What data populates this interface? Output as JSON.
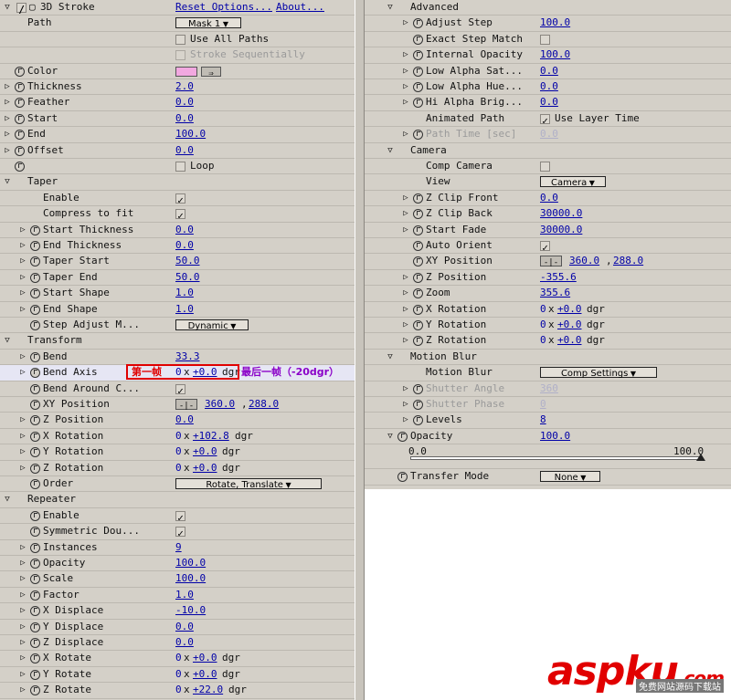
{
  "left_rows": [
    {
      "indent": 0,
      "twirl": "open",
      "fx": true,
      "label": "3D Stroke",
      "link1": "Reset Options...",
      "link2": "About..."
    },
    {
      "indent": 0,
      "label": "Path",
      "dropdown": "Mask 1"
    },
    {
      "indent": 0,
      "checkbox": false,
      "text": "Use All Paths"
    },
    {
      "indent": 0,
      "checkbox": false,
      "text": "Stroke Sequentially",
      "disabled": true
    },
    {
      "indent": 0,
      "stopwatch": true,
      "label": "Color",
      "swatch": "#f2a8e0"
    },
    {
      "indent": 0,
      "twirl": "closed",
      "stopwatch": true,
      "label": "Thickness",
      "value": "2.0"
    },
    {
      "indent": 0,
      "twirl": "closed",
      "stopwatch": true,
      "label": "Feather",
      "value": "0.0"
    },
    {
      "indent": 0,
      "twirl": "closed",
      "stopwatch": true,
      "label": "Start",
      "value": "0.0"
    },
    {
      "indent": 0,
      "twirl": "closed",
      "stopwatch": true,
      "label": "End",
      "value": "100.0"
    },
    {
      "indent": 0,
      "twirl": "closed",
      "stopwatch": true,
      "label": "Offset",
      "value": "0.0"
    },
    {
      "indent": 0,
      "stopwatch": true,
      "checkbox": false,
      "text": "Loop"
    },
    {
      "indent": 0,
      "twirl": "open",
      "label": "Taper"
    },
    {
      "indent": 1,
      "label": "Enable",
      "checkbox": true
    },
    {
      "indent": 1,
      "label": "Compress to fit",
      "checkbox": true
    },
    {
      "indent": 1,
      "twirl": "closed",
      "stopwatch": true,
      "label": "Start Thickness",
      "value": "0.0"
    },
    {
      "indent": 1,
      "twirl": "closed",
      "stopwatch": true,
      "label": "End Thickness",
      "value": "0.0"
    },
    {
      "indent": 1,
      "twirl": "closed",
      "stopwatch": true,
      "label": "Taper Start",
      "value": "50.0"
    },
    {
      "indent": 1,
      "twirl": "closed",
      "stopwatch": true,
      "label": "Taper End",
      "value": "50.0"
    },
    {
      "indent": 1,
      "twirl": "closed",
      "stopwatch": true,
      "label": "Start Shape",
      "value": "1.0"
    },
    {
      "indent": 1,
      "twirl": "closed",
      "stopwatch": true,
      "label": "End Shape",
      "value": "1.0"
    },
    {
      "indent": 1,
      "stopwatch": true,
      "label": "Step Adjust M...",
      "dropdown": "Dynamic"
    },
    {
      "indent": 0,
      "twirl": "open",
      "label": "Transform"
    },
    {
      "indent": 1,
      "twirl": "closed",
      "stopwatch": true,
      "label": "Bend",
      "value": "33.3"
    },
    {
      "indent": 1,
      "twirl": "closed",
      "stopwatch": true,
      "label": "Bend Axis",
      "angle": [
        "0",
        "+0.0"
      ],
      "selected": true,
      "annot_first": "第一帧",
      "annot_last": "最后一帧（-20dgr）"
    },
    {
      "indent": 1,
      "stopwatch": true,
      "label": "Bend Around C...",
      "checkbox": true
    },
    {
      "indent": 1,
      "stopwatch": true,
      "label": "XY Position",
      "xy": [
        "360.0",
        "288.0"
      ]
    },
    {
      "indent": 1,
      "twirl": "closed",
      "stopwatch": true,
      "label": "Z Position",
      "value": "0.0"
    },
    {
      "indent": 1,
      "twirl": "closed",
      "stopwatch": true,
      "label": "X Rotation",
      "angle": [
        "0",
        "+102.8"
      ]
    },
    {
      "indent": 1,
      "twirl": "closed",
      "stopwatch": true,
      "label": "Y Rotation",
      "angle": [
        "0",
        "+0.0"
      ]
    },
    {
      "indent": 1,
      "twirl": "closed",
      "stopwatch": true,
      "label": "Z Rotation",
      "angle": [
        "0",
        "+0.0"
      ]
    },
    {
      "indent": 1,
      "stopwatch": true,
      "label": "Order",
      "dropdown": "Rotate, Translate"
    },
    {
      "indent": 0,
      "twirl": "open",
      "label": "Repeater"
    },
    {
      "indent": 1,
      "stopwatch": true,
      "label": "Enable",
      "checkbox": true
    },
    {
      "indent": 1,
      "stopwatch": true,
      "label": "Symmetric Dou...",
      "checkbox": true
    },
    {
      "indent": 1,
      "twirl": "closed",
      "stopwatch": true,
      "label": "Instances",
      "value": "9"
    },
    {
      "indent": 1,
      "twirl": "closed",
      "stopwatch": true,
      "label": "Opacity",
      "value": "100.0"
    },
    {
      "indent": 1,
      "twirl": "closed",
      "stopwatch": true,
      "label": "Scale",
      "value": "100.0"
    },
    {
      "indent": 1,
      "twirl": "closed",
      "stopwatch": true,
      "label": "Factor",
      "value": "1.0"
    },
    {
      "indent": 1,
      "twirl": "closed",
      "stopwatch": true,
      "label": "X Displace",
      "value": "-10.0"
    },
    {
      "indent": 1,
      "twirl": "closed",
      "stopwatch": true,
      "label": "Y Displace",
      "value": "0.0"
    },
    {
      "indent": 1,
      "twirl": "closed",
      "stopwatch": true,
      "label": "Z Displace",
      "value": "0.0"
    },
    {
      "indent": 1,
      "twirl": "closed",
      "stopwatch": true,
      "label": "X Rotate",
      "angle": [
        "0",
        "+0.0"
      ]
    },
    {
      "indent": 1,
      "twirl": "closed",
      "stopwatch": true,
      "label": "Y Rotate",
      "angle": [
        "0",
        "+0.0"
      ]
    },
    {
      "indent": 1,
      "twirl": "closed",
      "stopwatch": true,
      "label": "Z Rotate",
      "angle": [
        "0",
        "+22.0"
      ]
    }
  ],
  "right_rows": [
    {
      "indent": 0,
      "twirl": "open",
      "label": "Advanced"
    },
    {
      "indent": 1,
      "twirl": "closed",
      "stopwatch": true,
      "label": "Adjust Step",
      "value": "100.0"
    },
    {
      "indent": 1,
      "stopwatch": true,
      "label": "Exact Step Match",
      "checkbox": false
    },
    {
      "indent": 1,
      "twirl": "closed",
      "stopwatch": true,
      "label": "Internal Opacity",
      "value": "100.0"
    },
    {
      "indent": 1,
      "twirl": "closed",
      "stopwatch": true,
      "label": "Low Alpha Sat...",
      "value": "0.0"
    },
    {
      "indent": 1,
      "twirl": "closed",
      "stopwatch": true,
      "label": "Low Alpha Hue...",
      "value": "0.0"
    },
    {
      "indent": 1,
      "twirl": "closed",
      "stopwatch": true,
      "label": "Hi Alpha Brig...",
      "value": "0.0"
    },
    {
      "indent": 1,
      "label": "Animated Path",
      "checkbox": true,
      "text": "Use Layer Time"
    },
    {
      "indent": 1,
      "twirl": "closed",
      "stopwatch": true,
      "label": "Path Time [sec]",
      "value": "0.0",
      "disabled": true
    },
    {
      "indent": 0,
      "twirl": "open",
      "label": "Camera"
    },
    {
      "indent": 1,
      "label": "Comp Camera",
      "checkbox": false
    },
    {
      "indent": 1,
      "label": "View",
      "dropdown": "Camera"
    },
    {
      "indent": 1,
      "twirl": "closed",
      "stopwatch": true,
      "label": "Z Clip Front",
      "value": "0.0"
    },
    {
      "indent": 1,
      "twirl": "closed",
      "stopwatch": true,
      "label": "Z Clip Back",
      "value": "30000.0"
    },
    {
      "indent": 1,
      "twirl": "closed",
      "stopwatch": true,
      "label": "Start Fade",
      "value": "30000.0"
    },
    {
      "indent": 1,
      "stopwatch": true,
      "label": "Auto Orient",
      "checkbox": true
    },
    {
      "indent": 1,
      "stopwatch": true,
      "label": "XY Position",
      "xy": [
        "360.0",
        "288.0"
      ]
    },
    {
      "indent": 1,
      "twirl": "closed",
      "stopwatch": true,
      "label": "Z Position",
      "value": "-355.6"
    },
    {
      "indent": 1,
      "twirl": "closed",
      "stopwatch": true,
      "label": "Zoom",
      "value": "355.6"
    },
    {
      "indent": 1,
      "twirl": "closed",
      "stopwatch": true,
      "label": "X Rotation",
      "angle": [
        "0",
        "+0.0"
      ]
    },
    {
      "indent": 1,
      "twirl": "closed",
      "stopwatch": true,
      "label": "Y Rotation",
      "angle": [
        "0",
        "+0.0"
      ]
    },
    {
      "indent": 1,
      "twirl": "closed",
      "stopwatch": true,
      "label": "Z Rotation",
      "angle": [
        "0",
        "+0.0"
      ]
    },
    {
      "indent": 0,
      "twirl": "open",
      "label": "Motion Blur"
    },
    {
      "indent": 1,
      "label": "Motion Blur",
      "dropdown": "Comp Settings"
    },
    {
      "indent": 1,
      "twirl": "closed",
      "stopwatch": true,
      "label": "Shutter Angle",
      "value": "360",
      "disabled": true
    },
    {
      "indent": 1,
      "twirl": "closed",
      "stopwatch": true,
      "label": "Shutter Phase",
      "value": "0",
      "disabled": true
    },
    {
      "indent": 1,
      "twirl": "closed",
      "stopwatch": true,
      "label": "Levels",
      "value": "8"
    },
    {
      "indent": 0,
      "twirl": "open",
      "stopwatch": true,
      "label": "Opacity",
      "value": "100.0"
    },
    {
      "indent": 0,
      "slider": true,
      "min": "0.0",
      "max": "100.0",
      "level": 1.0
    },
    {
      "indent": 0,
      "stopwatch": true,
      "label": "Transfer Mode",
      "dropdown": "None"
    }
  ],
  "angle_unit": "dgr",
  "watermark": {
    "main": "aspku",
    "suffix": ".com",
    "sub": "免费网站源码下载站"
  }
}
